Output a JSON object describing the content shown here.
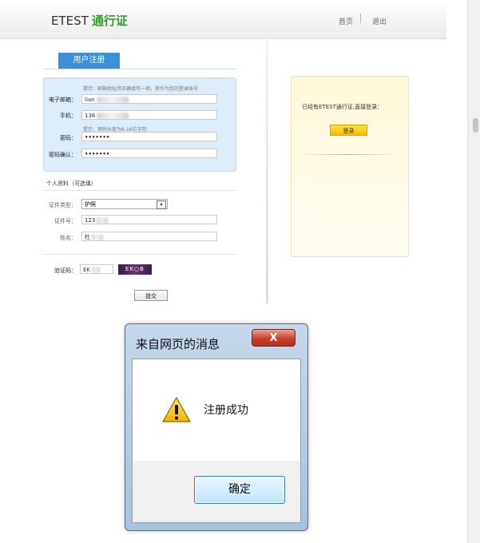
{
  "header": {
    "logo_prefix": "ETEST",
    "logo_highlight": "通行证",
    "nav_home": "首页",
    "nav_logout": "退出"
  },
  "register": {
    "tab_label": "用户注册",
    "hint_email": "提示：邮箱地址须正确填写一项，将作为您的登录账号",
    "email_label": "电子邮箱：",
    "email_value": "lian",
    "phone_label": "手机：",
    "phone_value": "136",
    "hint_password": "提示：密码长度为6-16位字符",
    "password_label": "密码：",
    "password_value": "•••••••",
    "confirm_label": "密码确认：",
    "confirm_value": "•••••••"
  },
  "profile": {
    "section_title": "个人资料（可选填）",
    "id_type_label": "证件类型：",
    "id_type_value": "护照",
    "id_no_label": "证件号：",
    "id_no_value": "123",
    "name_label": "姓名：",
    "name_value": "杜"
  },
  "captcha": {
    "label": "验证码：",
    "value": "EK",
    "image_text": "EK○B"
  },
  "submit_label": "提交",
  "login": {
    "prompt": "已经有ETEST通行证,直接登录：",
    "button": "登录"
  },
  "dialog": {
    "title": "来自网页的消息",
    "close": "X",
    "message": "注册成功",
    "ok": "确定",
    "icon": "warning-icon"
  },
  "colors": {
    "accent": "#3c8fd8",
    "logo_green": "#2f9d2a",
    "login_button": "#f5bc00"
  }
}
